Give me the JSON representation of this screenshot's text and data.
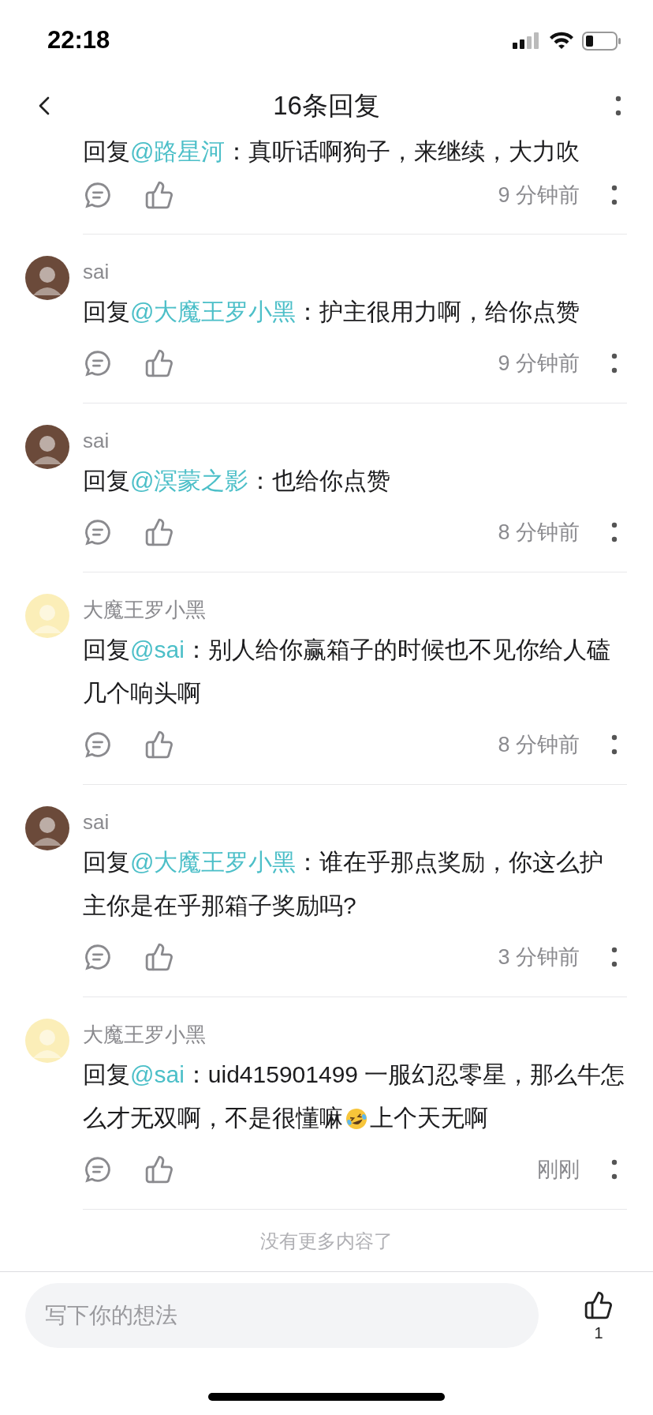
{
  "status_bar": {
    "time": "22:18"
  },
  "header": {
    "title": "16条回复"
  },
  "partial_comment": {
    "content": [
      {
        "kind": "text",
        "text": "回复"
      },
      {
        "kind": "mention",
        "text": "@路星河"
      },
      {
        "kind": "text",
        "text": "：真听话啊狗子，来继续，大力吹"
      }
    ],
    "time": "9 分钟前"
  },
  "comments": [
    {
      "author": "sai",
      "color": "#6b4a3a",
      "content": [
        {
          "kind": "text",
          "text": "回复"
        },
        {
          "kind": "mention",
          "text": "@大魔王罗小黑"
        },
        {
          "kind": "text",
          "text": "：护主很用力啊，给你点赞"
        }
      ],
      "time": "9 分钟前"
    },
    {
      "author": "sai",
      "color": "#6b4a3a",
      "content": [
        {
          "kind": "text",
          "text": "回复"
        },
        {
          "kind": "mention",
          "text": "@溟蒙之影"
        },
        {
          "kind": "text",
          "text": "：也给你点赞"
        }
      ],
      "time": "8 分钟前"
    },
    {
      "author": "大魔王罗小黑",
      "color": "#fbeeb8",
      "content": [
        {
          "kind": "text",
          "text": "回复"
        },
        {
          "kind": "mention",
          "text": "@sai"
        },
        {
          "kind": "text",
          "text": "：别人给你赢箱子的时候也不见你给人磕几个响头啊"
        }
      ],
      "time": "8 分钟前"
    },
    {
      "author": "sai",
      "color": "#6b4a3a",
      "content": [
        {
          "kind": "text",
          "text": "回复"
        },
        {
          "kind": "mention",
          "text": "@大魔王罗小黑"
        },
        {
          "kind": "text",
          "text": "：谁在乎那点奖励，你这么护主你是在乎那箱子奖励吗?"
        }
      ],
      "time": "3 分钟前"
    },
    {
      "author": "大魔王罗小黑",
      "color": "#fbeeb8",
      "content": [
        {
          "kind": "text",
          "text": "回复"
        },
        {
          "kind": "mention",
          "text": "@sai"
        },
        {
          "kind": "text",
          "text": "：uid415901499 一服幻忍零星，那么牛怎么才无双啊，不是很懂嘛"
        },
        {
          "kind": "emoji"
        },
        {
          "kind": "text",
          "text": "上个天无啊"
        }
      ],
      "time": "刚刚"
    }
  ],
  "end_note": "没有更多内容了",
  "composer": {
    "placeholder": "写下你的想法",
    "like_count": "1"
  }
}
